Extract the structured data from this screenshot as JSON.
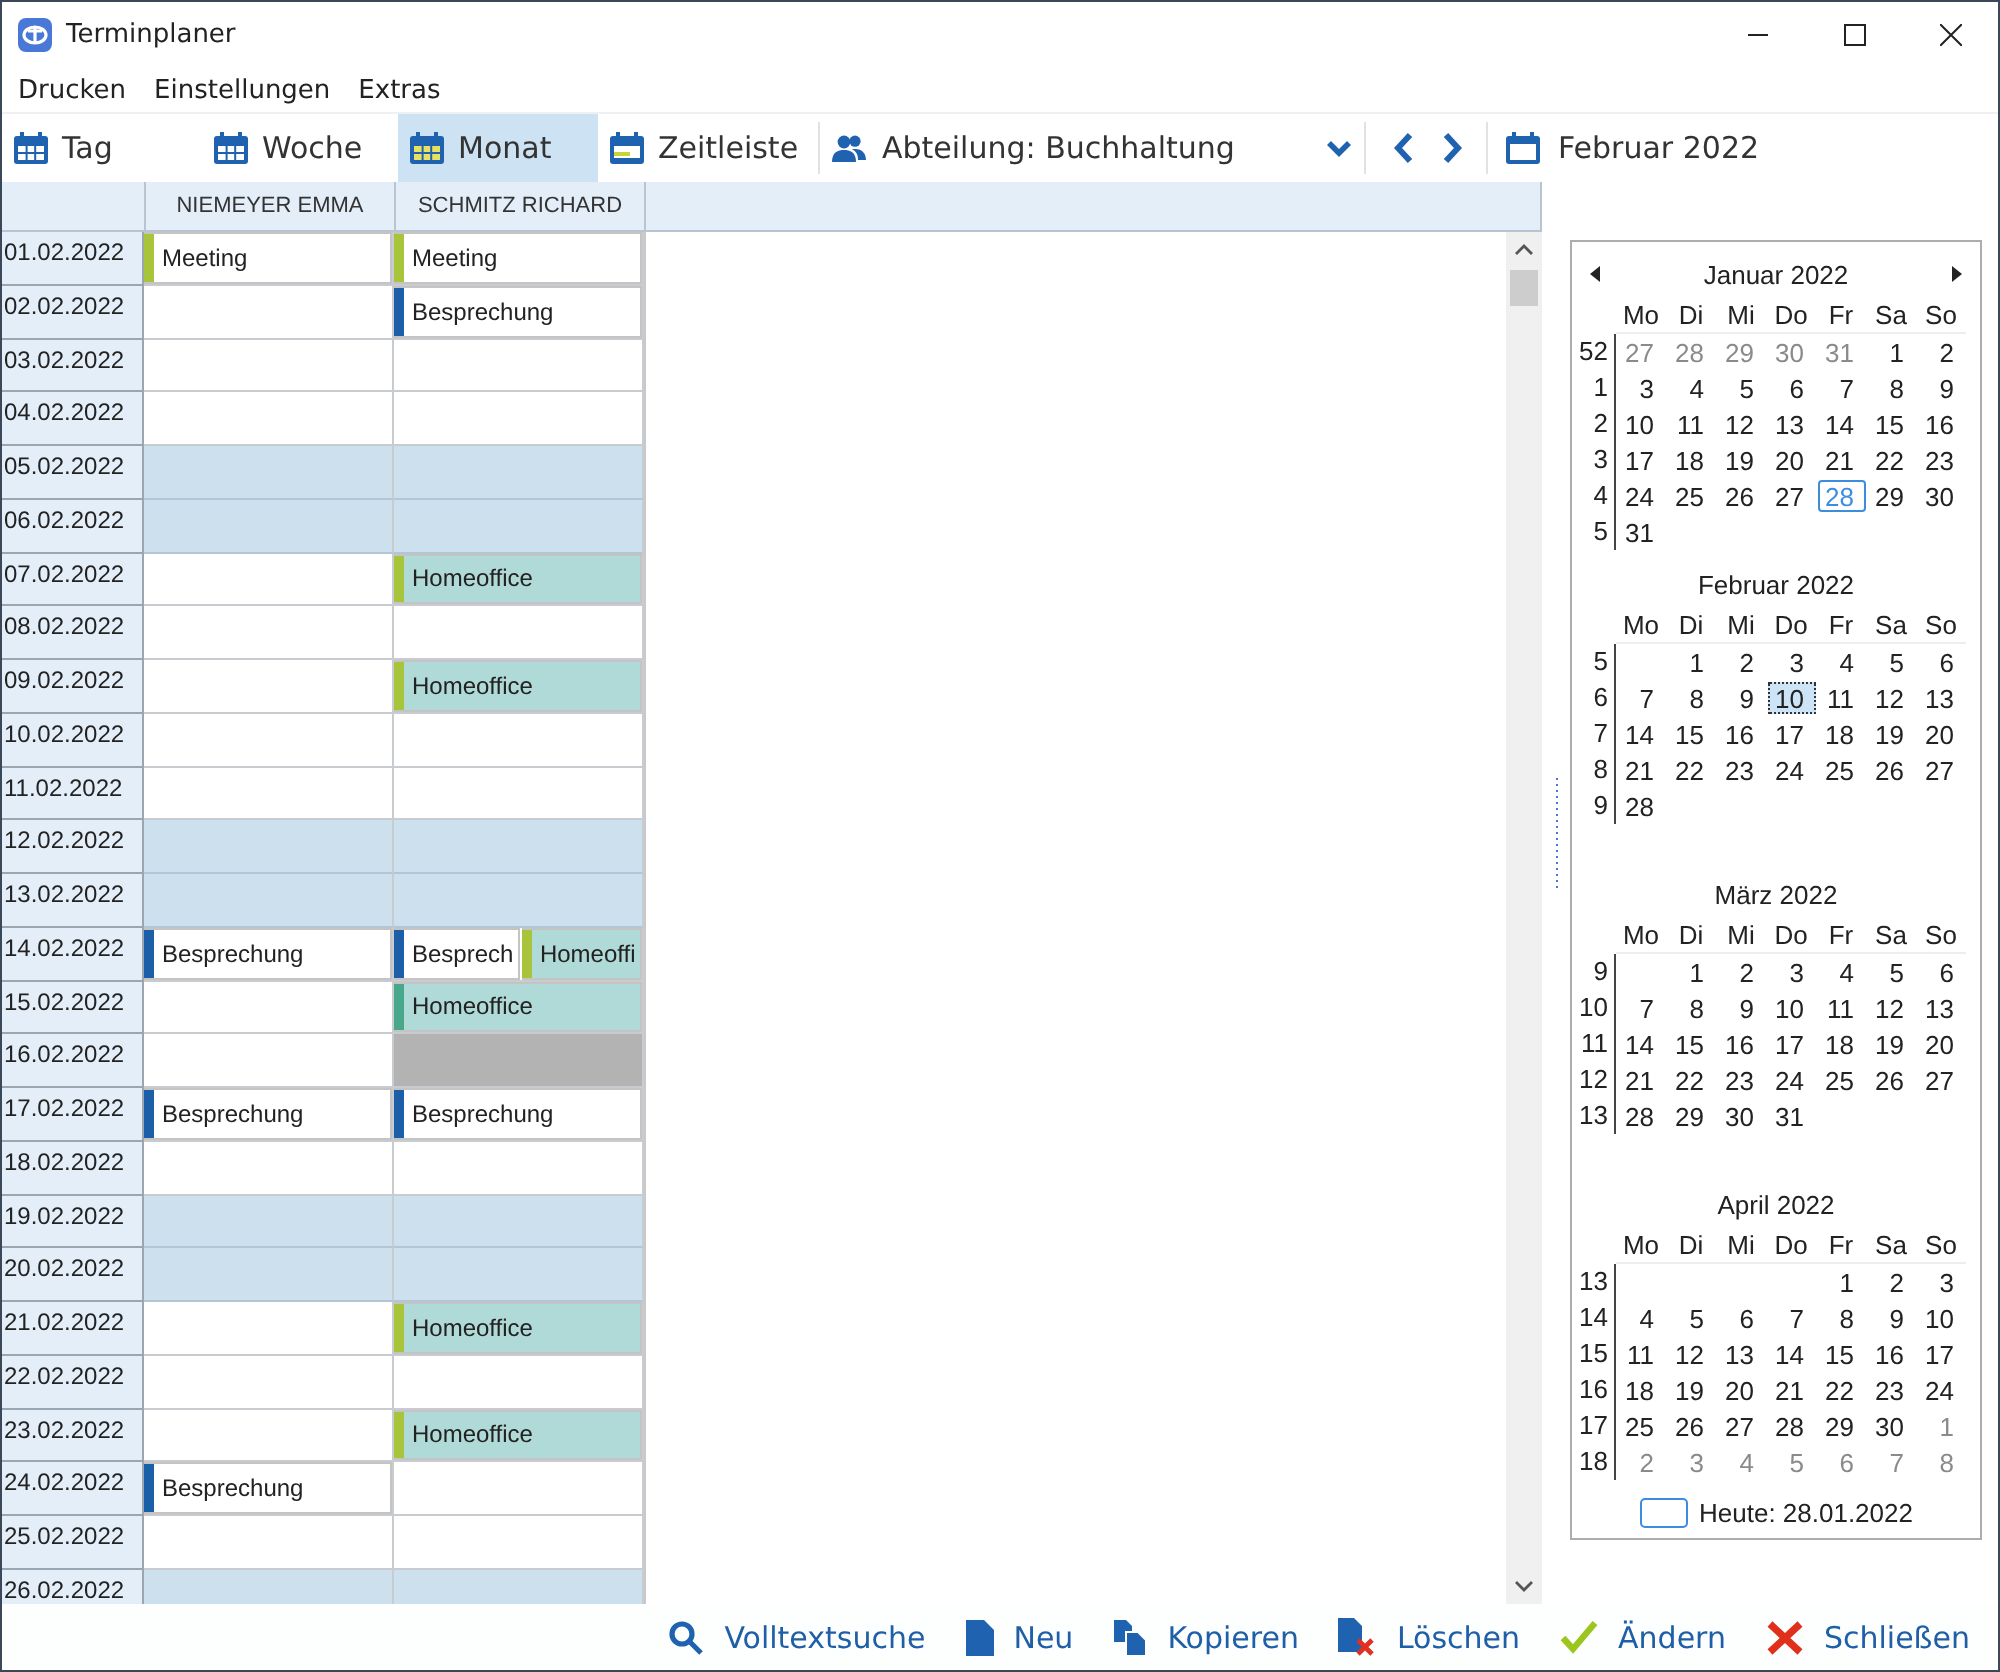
{
  "window": {
    "title": "Terminplaner"
  },
  "menu": [
    "Drucken",
    "Einstellungen",
    "Extras"
  ],
  "view_tabs": [
    {
      "label": "Tag",
      "selected": false
    },
    {
      "label": "Woche",
      "selected": false
    },
    {
      "label": "Monat",
      "selected": true
    },
    {
      "label": "Zeitleiste",
      "selected": false
    }
  ],
  "department": {
    "label": "Abteilung: Buchhaltung"
  },
  "period": {
    "label": "Februar 2022"
  },
  "grid": {
    "columns": [
      "NIEMEYER EMMA",
      "SCHMITZ RICHARD"
    ],
    "rows": [
      {
        "date": "01.02.2022",
        "weekend": false,
        "cells": [
          {
            "kind": "free",
            "events": [
              {
                "title": "Meeting",
                "kind": "appointment",
                "color": "#a8c43a"
              }
            ]
          },
          {
            "kind": "free",
            "events": [
              {
                "title": "Meeting",
                "kind": "appointment",
                "color": "#a8c43a"
              }
            ]
          }
        ]
      },
      {
        "date": "02.02.2022",
        "weekend": false,
        "cells": [
          {
            "kind": "free"
          },
          {
            "kind": "free",
            "events": [
              {
                "title": "Besprechung",
                "kind": "appointment",
                "color": "#1a5fa8"
              }
            ]
          }
        ]
      },
      {
        "date": "03.02.2022",
        "weekend": false,
        "cells": [
          {
            "kind": "free"
          },
          {
            "kind": "free"
          }
        ]
      },
      {
        "date": "04.02.2022",
        "weekend": false,
        "cells": [
          {
            "kind": "free"
          },
          {
            "kind": "free"
          }
        ]
      },
      {
        "date": "05.02.2022",
        "weekend": true,
        "cells": [
          {
            "kind": "free"
          },
          {
            "kind": "free"
          }
        ]
      },
      {
        "date": "06.02.2022",
        "weekend": true,
        "cells": [
          {
            "kind": "free"
          },
          {
            "kind": "free"
          }
        ]
      },
      {
        "date": "07.02.2022",
        "weekend": false,
        "cells": [
          {
            "kind": "free"
          },
          {
            "kind": "free",
            "events": [
              {
                "title": "Homeoffice",
                "kind": "absence",
                "color": "#a8c43a"
              }
            ]
          }
        ]
      },
      {
        "date": "08.02.2022",
        "weekend": false,
        "cells": [
          {
            "kind": "free"
          },
          {
            "kind": "free"
          }
        ]
      },
      {
        "date": "09.02.2022",
        "weekend": false,
        "cells": [
          {
            "kind": "free"
          },
          {
            "kind": "free",
            "events": [
              {
                "title": "Homeoffice",
                "kind": "absence",
                "color": "#a8c43a"
              }
            ]
          }
        ]
      },
      {
        "date": "10.02.2022",
        "weekend": false,
        "cells": [
          {
            "kind": "free"
          },
          {
            "kind": "free"
          }
        ]
      },
      {
        "date": "11.02.2022",
        "weekend": false,
        "cells": [
          {
            "kind": "free"
          },
          {
            "kind": "free"
          }
        ]
      },
      {
        "date": "12.02.2022",
        "weekend": true,
        "cells": [
          {
            "kind": "free"
          },
          {
            "kind": "free"
          }
        ]
      },
      {
        "date": "13.02.2022",
        "weekend": true,
        "cells": [
          {
            "kind": "free"
          },
          {
            "kind": "free"
          }
        ]
      },
      {
        "date": "14.02.2022",
        "weekend": false,
        "cells": [
          {
            "kind": "free",
            "events": [
              {
                "title": "Besprechung",
                "kind": "appointment",
                "color": "#1a5fa8"
              }
            ]
          },
          {
            "kind": "free",
            "events": [
              {
                "title": "Besprech",
                "kind": "appointment",
                "color": "#1a5fa8"
              },
              {
                "title": "Homeoffi",
                "kind": "absence",
                "color": "#a8c43a"
              }
            ]
          }
        ]
      },
      {
        "date": "15.02.2022",
        "weekend": false,
        "cells": [
          {
            "kind": "free"
          },
          {
            "kind": "free",
            "events": [
              {
                "title": "Homeoffice",
                "kind": "absence",
                "color": "#4aa88a"
              }
            ]
          }
        ]
      },
      {
        "date": "16.02.2022",
        "weekend": false,
        "cells": [
          {
            "kind": "free"
          },
          {
            "kind": "blocked"
          }
        ]
      },
      {
        "date": "17.02.2022",
        "weekend": false,
        "cells": [
          {
            "kind": "free",
            "events": [
              {
                "title": "Besprechung",
                "kind": "appointment",
                "color": "#1a5fa8"
              }
            ]
          },
          {
            "kind": "free",
            "events": [
              {
                "title": "Besprechung",
                "kind": "appointment",
                "color": "#1a5fa8"
              }
            ]
          }
        ]
      },
      {
        "date": "18.02.2022",
        "weekend": false,
        "cells": [
          {
            "kind": "free"
          },
          {
            "kind": "free"
          }
        ]
      },
      {
        "date": "19.02.2022",
        "weekend": true,
        "cells": [
          {
            "kind": "free"
          },
          {
            "kind": "free"
          }
        ]
      },
      {
        "date": "20.02.2022",
        "weekend": true,
        "cells": [
          {
            "kind": "free"
          },
          {
            "kind": "free"
          }
        ]
      },
      {
        "date": "21.02.2022",
        "weekend": false,
        "cells": [
          {
            "kind": "free"
          },
          {
            "kind": "free",
            "events": [
              {
                "title": "Homeoffice",
                "kind": "absence",
                "color": "#a8c43a"
              }
            ]
          }
        ]
      },
      {
        "date": "22.02.2022",
        "weekend": false,
        "cells": [
          {
            "kind": "free"
          },
          {
            "kind": "free"
          }
        ]
      },
      {
        "date": "23.02.2022",
        "weekend": false,
        "cells": [
          {
            "kind": "free"
          },
          {
            "kind": "free",
            "events": [
              {
                "title": "Homeoffice",
                "kind": "absence",
                "color": "#a8c43a"
              }
            ]
          }
        ]
      },
      {
        "date": "24.02.2022",
        "weekend": false,
        "cells": [
          {
            "kind": "free",
            "events": [
              {
                "title": "Besprechung",
                "kind": "appointment",
                "color": "#1a5fa8"
              }
            ]
          },
          {
            "kind": "free"
          }
        ]
      },
      {
        "date": "25.02.2022",
        "weekend": false,
        "cells": [
          {
            "kind": "free"
          },
          {
            "kind": "free"
          }
        ]
      },
      {
        "date": "26.02.2022",
        "weekend": true,
        "cells": [
          {
            "kind": "free"
          },
          {
            "kind": "free"
          }
        ]
      }
    ]
  },
  "calendar": {
    "months": [
      {
        "title": "Januar 2022",
        "weekdays": [
          "Mo",
          "Di",
          "Mi",
          "Do",
          "Fr",
          "Sa",
          "So"
        ],
        "weeks": [
          {
            "number": "52",
            "days": [
              {
                "d": "27",
                "kind": "other"
              },
              {
                "d": "28",
                "kind": "other"
              },
              {
                "d": "29",
                "kind": "other"
              },
              {
                "d": "30",
                "kind": "other"
              },
              {
                "d": "31",
                "kind": "other"
              },
              {
                "d": "1",
                "kind": "day"
              },
              {
                "d": "2",
                "kind": "day"
              }
            ]
          },
          {
            "number": "1",
            "days": [
              {
                "d": "3",
                "kind": "day"
              },
              {
                "d": "4",
                "kind": "day"
              },
              {
                "d": "5",
                "kind": "day"
              },
              {
                "d": "6",
                "kind": "day"
              },
              {
                "d": "7",
                "kind": "day"
              },
              {
                "d": "8",
                "kind": "day"
              },
              {
                "d": "9",
                "kind": "day"
              }
            ]
          },
          {
            "number": "2",
            "days": [
              {
                "d": "10",
                "kind": "day"
              },
              {
                "d": "11",
                "kind": "day"
              },
              {
                "d": "12",
                "kind": "day"
              },
              {
                "d": "13",
                "kind": "day"
              },
              {
                "d": "14",
                "kind": "day"
              },
              {
                "d": "15",
                "kind": "day"
              },
              {
                "d": "16",
                "kind": "day"
              }
            ]
          },
          {
            "number": "3",
            "days": [
              {
                "d": "17",
                "kind": "day"
              },
              {
                "d": "18",
                "kind": "day"
              },
              {
                "d": "19",
                "kind": "day"
              },
              {
                "d": "20",
                "kind": "day"
              },
              {
                "d": "21",
                "kind": "day"
              },
              {
                "d": "22",
                "kind": "day"
              },
              {
                "d": "23",
                "kind": "day"
              }
            ]
          },
          {
            "number": "4",
            "days": [
              {
                "d": "24",
                "kind": "day"
              },
              {
                "d": "25",
                "kind": "day"
              },
              {
                "d": "26",
                "kind": "day"
              },
              {
                "d": "27",
                "kind": "day"
              },
              {
                "d": "28",
                "kind": "today"
              },
              {
                "d": "29",
                "kind": "day"
              },
              {
                "d": "30",
                "kind": "day"
              }
            ]
          },
          {
            "number": "5",
            "days": [
              {
                "d": "31",
                "kind": "day"
              }
            ]
          }
        ]
      },
      {
        "title": "Februar 2022",
        "weekdays": [
          "Mo",
          "Di",
          "Mi",
          "Do",
          "Fr",
          "Sa",
          "So"
        ],
        "weeks": [
          {
            "number": "5",
            "days": [
              {
                "d": "1",
                "kind": "day"
              },
              {
                "d": "2",
                "kind": "day"
              },
              {
                "d": "3",
                "kind": "day"
              },
              {
                "d": "4",
                "kind": "day"
              },
              {
                "d": "5",
                "kind": "day"
              },
              {
                "d": "6",
                "kind": "day"
              }
            ]
          },
          {
            "number": "6",
            "days": [
              {
                "d": "7",
                "kind": "day"
              },
              {
                "d": "8",
                "kind": "day"
              },
              {
                "d": "9",
                "kind": "day"
              },
              {
                "d": "10",
                "kind": "selected"
              },
              {
                "d": "11",
                "kind": "day"
              },
              {
                "d": "12",
                "kind": "day"
              },
              {
                "d": "13",
                "kind": "day"
              }
            ]
          },
          {
            "number": "7",
            "days": [
              {
                "d": "14",
                "kind": "day"
              },
              {
                "d": "15",
                "kind": "day"
              },
              {
                "d": "16",
                "kind": "day"
              },
              {
                "d": "17",
                "kind": "day"
              },
              {
                "d": "18",
                "kind": "day"
              },
              {
                "d": "19",
                "kind": "day"
              },
              {
                "d": "20",
                "kind": "day"
              }
            ]
          },
          {
            "number": "8",
            "days": [
              {
                "d": "21",
                "kind": "day"
              },
              {
                "d": "22",
                "kind": "day"
              },
              {
                "d": "23",
                "kind": "day"
              },
              {
                "d": "24",
                "kind": "day"
              },
              {
                "d": "25",
                "kind": "day"
              },
              {
                "d": "26",
                "kind": "day"
              },
              {
                "d": "27",
                "kind": "day"
              }
            ]
          },
          {
            "number": "9",
            "days": [
              {
                "d": "28",
                "kind": "day"
              }
            ]
          }
        ]
      },
      {
        "title": "März 2022",
        "weekdays": [
          "Mo",
          "Di",
          "Mi",
          "Do",
          "Fr",
          "Sa",
          "So"
        ],
        "weeks": [
          {
            "number": "9",
            "days": [
              {
                "d": "1",
                "kind": "day"
              },
              {
                "d": "2",
                "kind": "day"
              },
              {
                "d": "3",
                "kind": "day"
              },
              {
                "d": "4",
                "kind": "day"
              },
              {
                "d": "5",
                "kind": "day"
              },
              {
                "d": "6",
                "kind": "day"
              }
            ]
          },
          {
            "number": "10",
            "days": [
              {
                "d": "7",
                "kind": "day"
              },
              {
                "d": "8",
                "kind": "day"
              },
              {
                "d": "9",
                "kind": "day"
              },
              {
                "d": "10",
                "kind": "day"
              },
              {
                "d": "11",
                "kind": "day"
              },
              {
                "d": "12",
                "kind": "day"
              },
              {
                "d": "13",
                "kind": "day"
              }
            ]
          },
          {
            "number": "11",
            "days": [
              {
                "d": "14",
                "kind": "day"
              },
              {
                "d": "15",
                "kind": "day"
              },
              {
                "d": "16",
                "kind": "day"
              },
              {
                "d": "17",
                "kind": "day"
              },
              {
                "d": "18",
                "kind": "day"
              },
              {
                "d": "19",
                "kind": "day"
              },
              {
                "d": "20",
                "kind": "day"
              }
            ]
          },
          {
            "number": "12",
            "days": [
              {
                "d": "21",
                "kind": "day"
              },
              {
                "d": "22",
                "kind": "day"
              },
              {
                "d": "23",
                "kind": "day"
              },
              {
                "d": "24",
                "kind": "day"
              },
              {
                "d": "25",
                "kind": "day"
              },
              {
                "d": "26",
                "kind": "day"
              },
              {
                "d": "27",
                "kind": "day"
              }
            ]
          },
          {
            "number": "13",
            "days": [
              {
                "d": "28",
                "kind": "day"
              },
              {
                "d": "29",
                "kind": "day"
              },
              {
                "d": "30",
                "kind": "day"
              },
              {
                "d": "31",
                "kind": "day"
              }
            ]
          }
        ]
      },
      {
        "title": "April 2022",
        "weekdays": [
          "Mo",
          "Di",
          "Mi",
          "Do",
          "Fr",
          "Sa",
          "So"
        ],
        "weeks": [
          {
            "number": "13",
            "days": [
              {
                "d": "1",
                "kind": "day"
              },
              {
                "d": "2",
                "kind": "day"
              },
              {
                "d": "3",
                "kind": "day"
              }
            ]
          },
          {
            "number": "14",
            "days": [
              {
                "d": "4",
                "kind": "day"
              },
              {
                "d": "5",
                "kind": "day"
              },
              {
                "d": "6",
                "kind": "day"
              },
              {
                "d": "7",
                "kind": "day"
              },
              {
                "d": "8",
                "kind": "day"
              },
              {
                "d": "9",
                "kind": "day"
              },
              {
                "d": "10",
                "kind": "day"
              }
            ]
          },
          {
            "number": "15",
            "days": [
              {
                "d": "11",
                "kind": "day"
              },
              {
                "d": "12",
                "kind": "day"
              },
              {
                "d": "13",
                "kind": "day"
              },
              {
                "d": "14",
                "kind": "day"
              },
              {
                "d": "15",
                "kind": "day"
              },
              {
                "d": "16",
                "kind": "day"
              },
              {
                "d": "17",
                "kind": "day"
              }
            ]
          },
          {
            "number": "16",
            "days": [
              {
                "d": "18",
                "kind": "day"
              },
              {
                "d": "19",
                "kind": "day"
              },
              {
                "d": "20",
                "kind": "day"
              },
              {
                "d": "21",
                "kind": "day"
              },
              {
                "d": "22",
                "kind": "day"
              },
              {
                "d": "23",
                "kind": "day"
              },
              {
                "d": "24",
                "kind": "day"
              }
            ]
          },
          {
            "number": "17",
            "days": [
              {
                "d": "25",
                "kind": "day"
              },
              {
                "d": "26",
                "kind": "day"
              },
              {
                "d": "27",
                "kind": "day"
              },
              {
                "d": "28",
                "kind": "day"
              },
              {
                "d": "29",
                "kind": "day"
              },
              {
                "d": "30",
                "kind": "day"
              },
              {
                "d": "1",
                "kind": "other"
              }
            ]
          },
          {
            "number": "18",
            "days": [
              {
                "d": "2",
                "kind": "other"
              },
              {
                "d": "3",
                "kind": "other"
              },
              {
                "d": "4",
                "kind": "other"
              },
              {
                "d": "5",
                "kind": "other"
              },
              {
                "d": "6",
                "kind": "other"
              },
              {
                "d": "7",
                "kind": "other"
              },
              {
                "d": "8",
                "kind": "other"
              }
            ]
          }
        ]
      }
    ],
    "today_label": "Heute: 28.01.2022"
  },
  "actions": [
    {
      "label": "Volltextsuche",
      "kind": "search"
    },
    {
      "label": "Neu",
      "kind": "new"
    },
    {
      "label": "Kopieren",
      "kind": "copy"
    },
    {
      "label": "Löschen",
      "kind": "delete"
    },
    {
      "label": "Ändern",
      "kind": "edit"
    },
    {
      "label": "Schließen",
      "kind": "close"
    }
  ]
}
